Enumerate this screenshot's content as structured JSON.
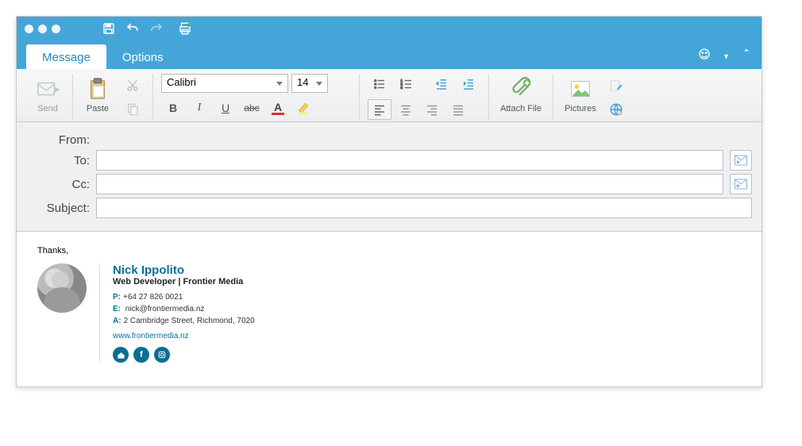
{
  "tabs": {
    "message": "Message",
    "options": "Options"
  },
  "ribbon": {
    "send": "Send",
    "paste": "Paste",
    "font_name": "Calibri",
    "font_size": "14",
    "attach": "Attach File",
    "pictures": "Pictures",
    "format": {
      "bold": "B",
      "italic": "I",
      "underline": "U",
      "strike": "abc"
    }
  },
  "fields": {
    "from_label": "From:",
    "to_label": "To:",
    "cc_label": "Cc:",
    "subject_label": "Subject:",
    "from_value": "",
    "to_value": "",
    "cc_value": "",
    "subject_value": ""
  },
  "body": {
    "thanks": "Thanks,",
    "name": "Nick Ippolito",
    "role": "Web Developer | Frontier Media",
    "phone_label": "P:",
    "phone": "+64 27 826 0021",
    "email_label": "E:",
    "email": "nick@frontiermedia.nz",
    "addr_label": "A:",
    "addr": "2 Cambridge Street, Richmond, 7020",
    "url": "www.frontiermedia.nz"
  }
}
